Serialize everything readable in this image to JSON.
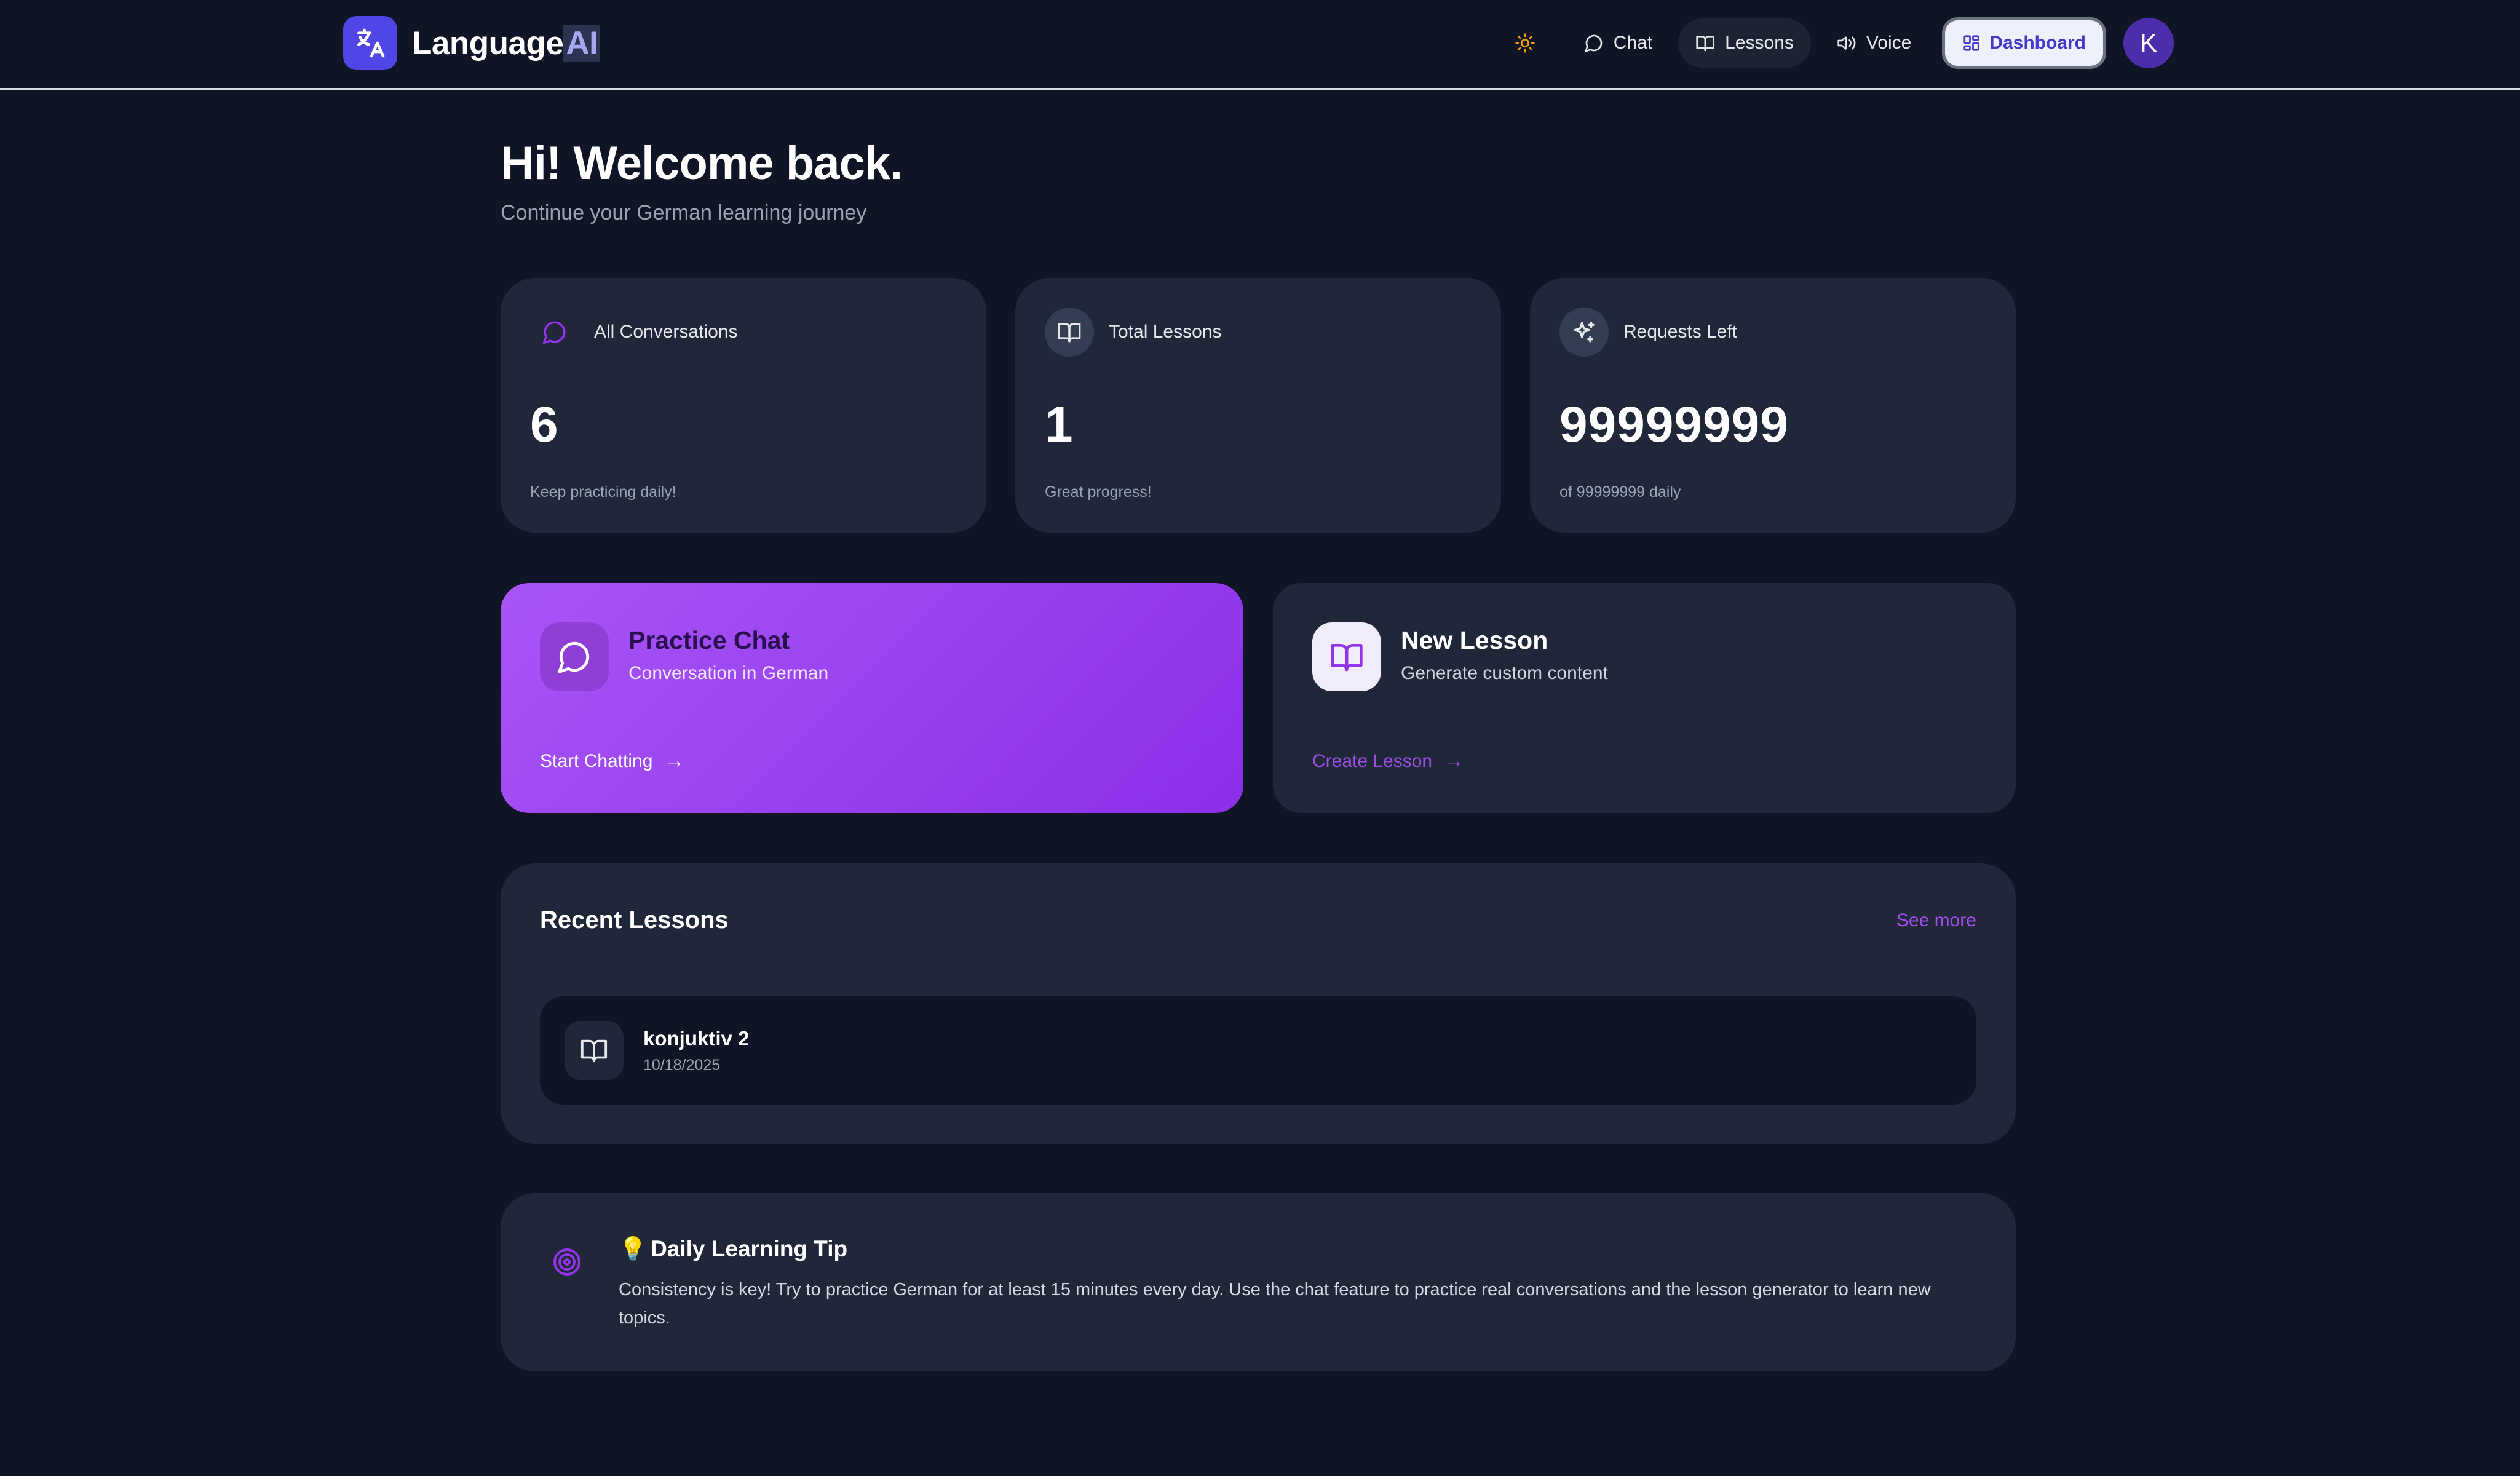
{
  "header": {
    "brand_name": "Language",
    "brand_suffix": "AI",
    "nav": [
      {
        "label": "Chat",
        "icon": "chat-bubble-icon",
        "active": false
      },
      {
        "label": "Lessons",
        "icon": "book-icon",
        "active": true
      },
      {
        "label": "Voice",
        "icon": "speaker-icon",
        "active": false
      }
    ],
    "dashboard_label": "Dashboard",
    "theme_icon": "sun-icon",
    "avatar_initial": "K"
  },
  "greeting": {
    "title": "Hi! Welcome back.",
    "subtitle": "Continue your German learning journey"
  },
  "stats": [
    {
      "label": "All Conversations",
      "value": "6",
      "sub": "Keep practicing daily!",
      "icon": "chat-bubble-icon"
    },
    {
      "label": "Total Lessons",
      "value": "1",
      "sub": "Great progress!",
      "icon": "book-icon"
    },
    {
      "label": "Requests Left",
      "value": "99999999",
      "sub": "of 99999999 daily",
      "icon": "sparkles-icon"
    }
  ],
  "actions": {
    "practice": {
      "title": "Practice Chat",
      "desc": "Conversation in German",
      "link": "Start Chatting",
      "arrow": "→"
    },
    "lesson": {
      "title": "New Lesson",
      "desc": "Generate custom content",
      "link": "Create Lesson",
      "arrow": "→"
    }
  },
  "recent": {
    "title": "Recent Lessons",
    "see_more": "See more",
    "items": [
      {
        "name": "konjuktiv 2",
        "date": "10/18/2025"
      }
    ]
  },
  "tip": {
    "bulb": "💡",
    "title": "Daily Learning Tip",
    "text": "Consistency is key! Try to practice German for at least 15 minutes every day. Use the chat feature to practice real conversations and the lesson generator to learn new topics."
  },
  "colors": {
    "background": "#0f1524",
    "card": "#1f2739",
    "accent": "#a855f7",
    "brand": "#4f46e5",
    "theme_toggle": "#f59e0b"
  }
}
